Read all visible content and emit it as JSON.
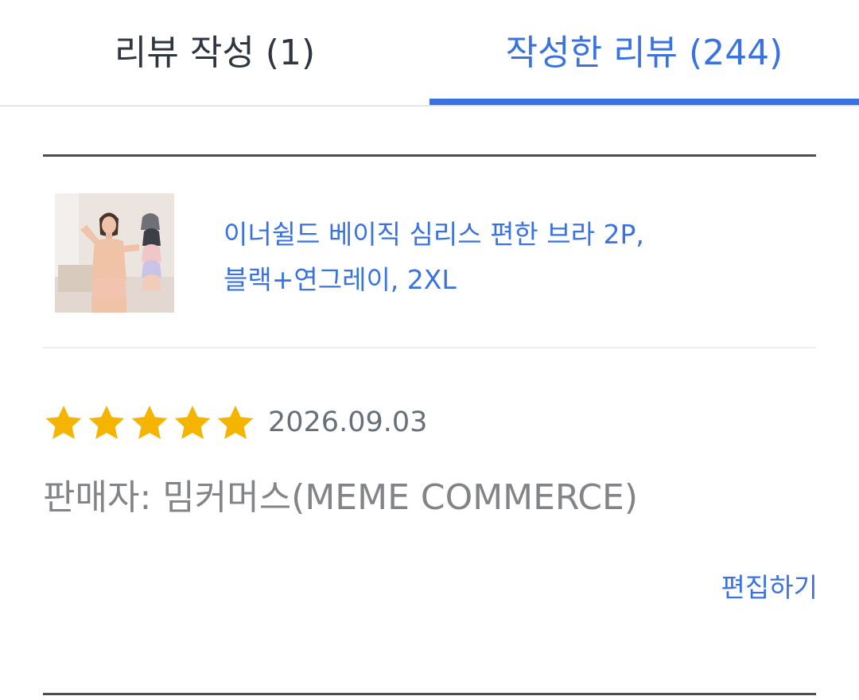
{
  "tabs": {
    "write_review": "리뷰 작성 (1)",
    "written_reviews": "작성한 리뷰 (244)"
  },
  "product": {
    "title_line1": "이너쉴드 베이직 심리스 편한 브라 2P,",
    "title_line2": "블랙+연그레이, 2XL"
  },
  "review": {
    "rating": 5,
    "max_rating": 5,
    "date": "2026.09.03",
    "seller": "판매자: 밈커머스(MEME COMMERCE)",
    "edit_label": "편집하기"
  },
  "colors": {
    "accent": "#3a73e0",
    "star": "#f5b400",
    "tab_inactive": "#2f3640",
    "muted_text": "#828487"
  },
  "icons": {
    "star": "star-icon",
    "thumbnail": "product-thumbnail"
  }
}
